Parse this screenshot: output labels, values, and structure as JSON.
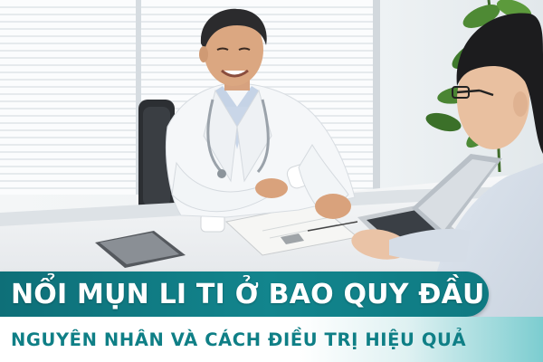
{
  "title": {
    "main": "NỔI MỤN LI TI Ở BAO QUY ĐẦU",
    "subtitle": "NGUYÊN NHÂN VÀ CÁCH ĐIỀU TRỊ HIỆU QUẢ"
  },
  "colors": {
    "banner_teal": "#0f7a82",
    "subtitle_text": "#0f7f86",
    "banner_text": "#ffffff"
  }
}
